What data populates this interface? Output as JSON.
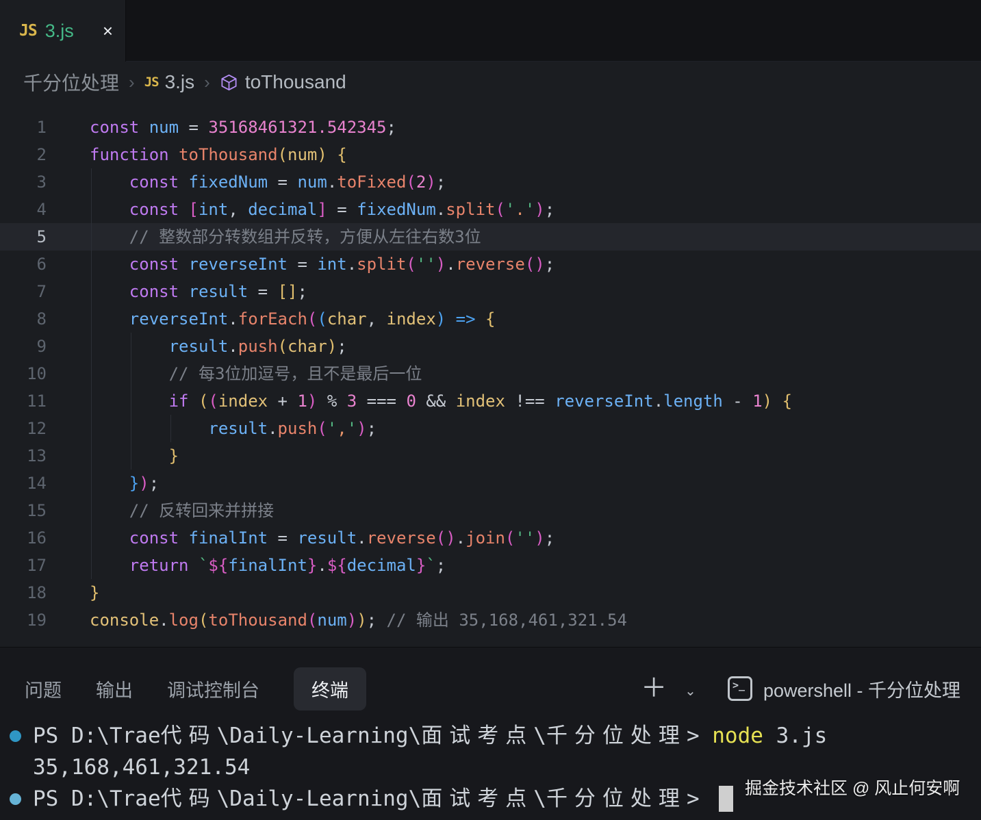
{
  "tab_bar": {
    "active_tab": {
      "icon": "JS",
      "file": "3.js",
      "close": "×"
    }
  },
  "breadcrumb": {
    "folder": "千分位处理",
    "separator": "›",
    "file_icon": "JS",
    "file": "3.js",
    "symbol_icon": "cube-icon",
    "symbol": "toThousand"
  },
  "editor": {
    "active_line": 5,
    "lines": [
      {
        "num": "1",
        "indent": 0,
        "tokens": [
          [
            "kw",
            "const"
          ],
          [
            "pln",
            " "
          ],
          [
            "var",
            "num"
          ],
          [
            "pln",
            " = "
          ],
          [
            "num",
            "35168461321.542345"
          ],
          [
            "pln",
            ";"
          ]
        ]
      },
      {
        "num": "2",
        "indent": 0,
        "tokens": [
          [
            "kw",
            "function"
          ],
          [
            "pln",
            " "
          ],
          [
            "fn",
            "toThousand"
          ],
          [
            "b1",
            "("
          ],
          [
            "param",
            "num"
          ],
          [
            "b1",
            ")"
          ],
          [
            "pln",
            " "
          ],
          [
            "b1",
            "{"
          ]
        ]
      },
      {
        "num": "3",
        "indent": 4,
        "tokens": [
          [
            "kw",
            "const"
          ],
          [
            "pln",
            " "
          ],
          [
            "var",
            "fixedNum"
          ],
          [
            "pln",
            " = "
          ],
          [
            "var",
            "num"
          ],
          [
            "pln",
            "."
          ],
          [
            "fn",
            "toFixed"
          ],
          [
            "b2",
            "("
          ],
          [
            "num",
            "2"
          ],
          [
            "b2",
            ")"
          ],
          [
            "pln",
            ";"
          ]
        ]
      },
      {
        "num": "4",
        "indent": 4,
        "tokens": [
          [
            "kw",
            "const"
          ],
          [
            "pln",
            " "
          ],
          [
            "b2",
            "["
          ],
          [
            "var",
            "int"
          ],
          [
            "pln",
            ", "
          ],
          [
            "var",
            "decimal"
          ],
          [
            "b2",
            "]"
          ],
          [
            "pln",
            " = "
          ],
          [
            "var",
            "fixedNum"
          ],
          [
            "pln",
            "."
          ],
          [
            "fn",
            "split"
          ],
          [
            "b2",
            "("
          ],
          [
            "strq",
            "'"
          ],
          [
            "str",
            "."
          ],
          [
            "strq",
            "'"
          ],
          [
            "b2",
            ")"
          ],
          [
            "pln",
            ";"
          ]
        ]
      },
      {
        "num": "5",
        "indent": 4,
        "tokens": [
          [
            "cm",
            "// 整数部分转数组并反转，方便从左往右数3位"
          ]
        ]
      },
      {
        "num": "6",
        "indent": 4,
        "tokens": [
          [
            "kw",
            "const"
          ],
          [
            "pln",
            " "
          ],
          [
            "var",
            "reverseInt"
          ],
          [
            "pln",
            " = "
          ],
          [
            "var",
            "int"
          ],
          [
            "pln",
            "."
          ],
          [
            "fn",
            "split"
          ],
          [
            "b2",
            "("
          ],
          [
            "strq",
            "''"
          ],
          [
            "b2",
            ")"
          ],
          [
            "pln",
            "."
          ],
          [
            "fn",
            "reverse"
          ],
          [
            "b2",
            "()"
          ],
          [
            "pln",
            ";"
          ]
        ]
      },
      {
        "num": "7",
        "indent": 4,
        "tokens": [
          [
            "kw",
            "const"
          ],
          [
            "pln",
            " "
          ],
          [
            "var",
            "result"
          ],
          [
            "pln",
            " = "
          ],
          [
            "b1",
            "[]"
          ],
          [
            "pln",
            ";"
          ]
        ]
      },
      {
        "num": "8",
        "indent": 4,
        "tokens": [
          [
            "var",
            "reverseInt"
          ],
          [
            "pln",
            "."
          ],
          [
            "fn",
            "forEach"
          ],
          [
            "b2",
            "("
          ],
          [
            "b3",
            "("
          ],
          [
            "param",
            "char"
          ],
          [
            "pln",
            ", "
          ],
          [
            "param",
            "index"
          ],
          [
            "b3",
            ")"
          ],
          [
            "pln",
            " "
          ],
          [
            "b3",
            "=>"
          ],
          [
            "pln",
            " "
          ],
          [
            "b1",
            "{"
          ]
        ]
      },
      {
        "num": "9",
        "indent": 8,
        "tokens": [
          [
            "var",
            "result"
          ],
          [
            "pln",
            "."
          ],
          [
            "fn",
            "push"
          ],
          [
            "b1",
            "("
          ],
          [
            "param",
            "char"
          ],
          [
            "b1",
            ")"
          ],
          [
            "pln",
            ";"
          ]
        ]
      },
      {
        "num": "10",
        "indent": 8,
        "tokens": [
          [
            "cm",
            "// 每3位加逗号，且不是最后一位"
          ]
        ]
      },
      {
        "num": "11",
        "indent": 8,
        "tokens": [
          [
            "kw",
            "if"
          ],
          [
            "pln",
            " "
          ],
          [
            "b1",
            "("
          ],
          [
            "b2",
            "("
          ],
          [
            "param",
            "index"
          ],
          [
            "pln",
            " + "
          ],
          [
            "num",
            "1"
          ],
          [
            "b2",
            ")"
          ],
          [
            "pln",
            " % "
          ],
          [
            "num",
            "3"
          ],
          [
            "pln",
            " === "
          ],
          [
            "num",
            "0"
          ],
          [
            "pln",
            " && "
          ],
          [
            "param",
            "index"
          ],
          [
            "pln",
            " !== "
          ],
          [
            "var",
            "reverseInt"
          ],
          [
            "pln",
            "."
          ],
          [
            "var",
            "length"
          ],
          [
            "pln",
            " - "
          ],
          [
            "num",
            "1"
          ],
          [
            "b1",
            ")"
          ],
          [
            "pln",
            " "
          ],
          [
            "b1",
            "{"
          ]
        ]
      },
      {
        "num": "12",
        "indent": 12,
        "tokens": [
          [
            "var",
            "result"
          ],
          [
            "pln",
            "."
          ],
          [
            "fn",
            "push"
          ],
          [
            "b2",
            "("
          ],
          [
            "strq",
            "'"
          ],
          [
            "str",
            ","
          ],
          [
            "strq",
            "'"
          ],
          [
            "b2",
            ")"
          ],
          [
            "pln",
            ";"
          ]
        ]
      },
      {
        "num": "13",
        "indent": 8,
        "tokens": [
          [
            "b1",
            "}"
          ]
        ]
      },
      {
        "num": "14",
        "indent": 4,
        "tokens": [
          [
            "b3",
            "}"
          ],
          [
            "b2",
            ")"
          ],
          [
            "pln",
            ";"
          ]
        ]
      },
      {
        "num": "15",
        "indent": 4,
        "tokens": [
          [
            "cm",
            "// 反转回来并拼接"
          ]
        ]
      },
      {
        "num": "16",
        "indent": 4,
        "tokens": [
          [
            "kw",
            "const"
          ],
          [
            "pln",
            " "
          ],
          [
            "var",
            "finalInt"
          ],
          [
            "pln",
            " = "
          ],
          [
            "var",
            "result"
          ],
          [
            "pln",
            "."
          ],
          [
            "fn",
            "reverse"
          ],
          [
            "b2",
            "()"
          ],
          [
            "pln",
            "."
          ],
          [
            "fn",
            "join"
          ],
          [
            "b2",
            "("
          ],
          [
            "strq",
            "''"
          ],
          [
            "b2",
            ")"
          ],
          [
            "pln",
            ";"
          ]
        ]
      },
      {
        "num": "17",
        "indent": 4,
        "tokens": [
          [
            "kw",
            "return"
          ],
          [
            "pln",
            " "
          ],
          [
            "strq",
            "`"
          ],
          [
            "b2",
            "${"
          ],
          [
            "var",
            "finalInt"
          ],
          [
            "b2",
            "}"
          ],
          [
            "pln",
            "."
          ],
          [
            "b2",
            "${"
          ],
          [
            "var",
            "decimal"
          ],
          [
            "b2",
            "}"
          ],
          [
            "strq",
            "`"
          ],
          [
            "pln",
            ";"
          ]
        ]
      },
      {
        "num": "18",
        "indent": 0,
        "tokens": [
          [
            "b1",
            "}"
          ]
        ]
      },
      {
        "num": "19",
        "indent": 0,
        "tokens": [
          [
            "param",
            "console"
          ],
          [
            "pln",
            "."
          ],
          [
            "fn",
            "log"
          ],
          [
            "b1",
            "("
          ],
          [
            "fn",
            "toThousand"
          ],
          [
            "b2",
            "("
          ],
          [
            "var",
            "num"
          ],
          [
            "b2",
            ")"
          ],
          [
            "b1",
            ")"
          ],
          [
            "pln",
            "; "
          ],
          [
            "cm",
            "// 输出 35,168,461,321.54"
          ]
        ]
      }
    ]
  },
  "panel": {
    "tabs": [
      {
        "label": "问题",
        "active": false
      },
      {
        "label": "输出",
        "active": false
      },
      {
        "label": "调试控制台",
        "active": false
      },
      {
        "label": "终端",
        "active": true
      }
    ],
    "actions": {
      "new_terminal": "＋",
      "dropdown": "⌄",
      "shell_icon": "terminal-icon",
      "shell_label": "powershell - 千分位处理"
    }
  },
  "terminal": {
    "lines": [
      {
        "bullet": "solid",
        "cursor": false,
        "segments": [
          [
            "t",
            "PS D:\\Trae"
          ],
          [
            "cjk",
            "代码"
          ],
          [
            "t",
            "\\Daily-Learning\\"
          ],
          [
            "cjk",
            "面试考点"
          ],
          [
            "t",
            "\\"
          ],
          [
            "cjk",
            "千分位处理"
          ],
          [
            "t",
            "> "
          ],
          [
            "cmd",
            "node"
          ],
          [
            "t",
            " 3.js"
          ]
        ]
      },
      {
        "bullet": "none",
        "cursor": false,
        "segments": [
          [
            "t",
            "35,168,461,321.54"
          ]
        ]
      },
      {
        "bullet": "light",
        "cursor": true,
        "segments": [
          [
            "t",
            "PS D:\\Trae"
          ],
          [
            "cjk",
            "代码"
          ],
          [
            "t",
            "\\Daily-Learning\\"
          ],
          [
            "cjk",
            "面试考点"
          ],
          [
            "t",
            "\\"
          ],
          [
            "cjk",
            "千分位处理"
          ],
          [
            "t",
            "> "
          ]
        ]
      }
    ],
    "bullet_colors": {
      "solid": "#2f96c4",
      "light": "#66b3d6"
    }
  },
  "watermark": {
    "text": "掘金技术社区 @ 风止何安啊"
  },
  "colors": {
    "editor_bg": "#1b1d21",
    "tabstrip_bg": "#121316",
    "panel_bg": "#17181c",
    "current_line": "#24262c",
    "keyword": "#bf7af0",
    "variable": "#6cb1f5",
    "function": "#e8846b",
    "number": "#e983cf",
    "string_quote": "#54b883",
    "comment": "#7b8089",
    "file_name_modified": "#45b987",
    "js_badge": "#d9b64c",
    "node_command": "#e6e153"
  }
}
